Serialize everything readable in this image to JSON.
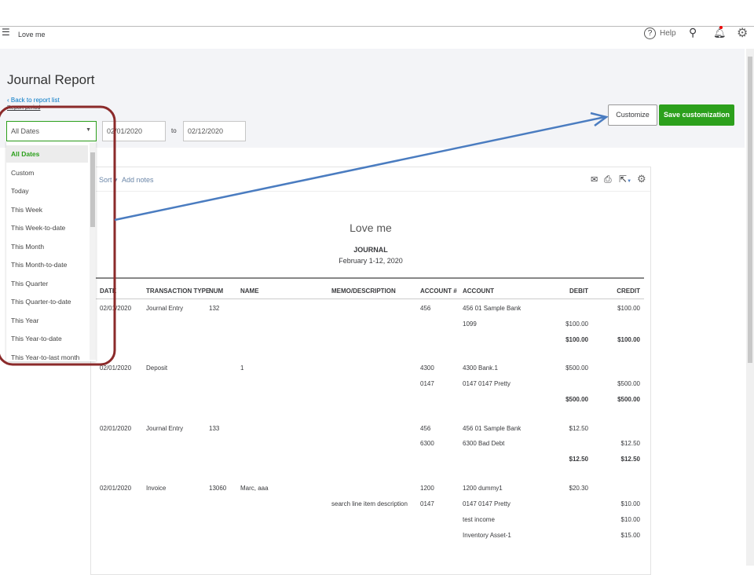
{
  "topbar": {
    "company": "Love me",
    "help": "Help"
  },
  "page": {
    "title": "Journal Report",
    "back": "Back to report list",
    "period_label": "Report period",
    "period": "All Dates",
    "from": "02/01/2020",
    "to_label": "to",
    "to": "02/12/2020"
  },
  "buttons": {
    "customize": "Customize",
    "save": "Save customization"
  },
  "dropdown": [
    "All Dates",
    "Custom",
    "Today",
    "This Week",
    "This Week-to-date",
    "This Month",
    "This Month-to-date",
    "This Quarter",
    "This Quarter-to-date",
    "This Year",
    "This Year-to-date",
    "This Year-to-last month"
  ],
  "toolbar": {
    "sort": "Sort",
    "notes": "Add notes"
  },
  "report": {
    "company": "Love me",
    "title": "JOURNAL",
    "range": "February 1-12, 2020"
  },
  "columns": [
    "DATE",
    "TRANSACTION TYPE",
    "NUM",
    "NAME",
    "MEMO/DESCRIPTION",
    "ACCOUNT #",
    "ACCOUNT",
    "DEBIT",
    "CREDIT"
  ],
  "rows": [
    [
      "02/01/2020",
      "Journal Entry",
      "132",
      "",
      "",
      "456",
      "456 01 Sample Bank",
      "",
      "$100.00"
    ],
    [
      "",
      "",
      "",
      "",
      "",
      "",
      "1099",
      "$100.00",
      ""
    ],
    [
      "",
      "",
      "",
      "",
      "",
      "",
      "",
      "$100.00",
      "$100.00"
    ],
    [
      "02/01/2020",
      "Deposit",
      "",
      "1",
      "",
      "4300",
      "4300 Bank.1",
      "$500.00",
      ""
    ],
    [
      "",
      "",
      "",
      "",
      "",
      "0147",
      "0147 0147 Pretty",
      "",
      "$500.00"
    ],
    [
      "",
      "",
      "",
      "",
      "",
      "",
      "",
      "$500.00",
      "$500.00"
    ],
    [
      "02/01/2020",
      "Journal Entry",
      "133",
      "",
      "",
      "456",
      "456 01 Sample Bank",
      "$12.50",
      ""
    ],
    [
      "",
      "",
      "",
      "",
      "",
      "6300",
      "6300 Bad Debt",
      "",
      "$12.50"
    ],
    [
      "",
      "",
      "",
      "",
      "",
      "",
      "",
      "$12.50",
      "$12.50"
    ],
    [
      "02/01/2020",
      "Invoice",
      "13060",
      "Marc, aaa",
      "",
      "1200",
      "1200 dummy1",
      "$20.30",
      ""
    ],
    [
      "",
      "",
      "",
      "",
      "search line item description",
      "0147",
      "0147 0147 Pretty",
      "",
      "$10.00"
    ],
    [
      "",
      "",
      "",
      "",
      "",
      "",
      "test income",
      "",
      "$10.00"
    ],
    [
      "",
      "",
      "",
      "",
      "",
      "",
      "Inventory Asset-1",
      "",
      "$15.00"
    ]
  ],
  "colors": {
    "green": "#2ca01c",
    "annotation": "#8b2a2a",
    "arrow": "#4a7cc0"
  }
}
